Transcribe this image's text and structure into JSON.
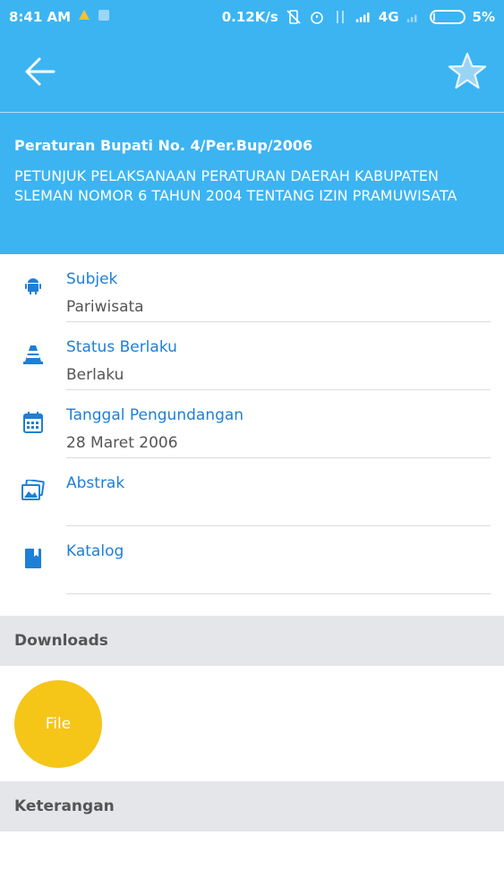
{
  "status_bar": {
    "time": "8:41 AM",
    "speed": "0.12K/s",
    "network": "4G",
    "battery": "5%"
  },
  "toolbar": {
    "back_icon": "arrow-left-icon",
    "favorite_icon": "star-icon"
  },
  "regulation": {
    "title": "Peraturan Bupati No. 4/Per.Bup/2006",
    "description": "PETUNJUK PELAKSANAAN PERATURAN DAERAH KABUPATEN SLEMAN NOMOR 6 TAHUN 2004 TENTANG IZIN PRAMUWISATA"
  },
  "details": [
    {
      "label": "Subjek",
      "value": "Pariwisata",
      "icon": "android-icon"
    },
    {
      "label": "Status Berlaku",
      "value": "Berlaku",
      "icon": "cone-icon"
    },
    {
      "label": "Tanggal Pengundangan",
      "value": "28 Maret 2006",
      "icon": "calendar-icon"
    },
    {
      "label": "Abstrak",
      "value": "",
      "icon": "photos-icon"
    },
    {
      "label": "Katalog",
      "value": "",
      "icon": "book-icon"
    }
  ],
  "downloads": {
    "heading": "Downloads",
    "file_label": "File"
  },
  "keterangan": {
    "heading": "Keterangan"
  },
  "colors": {
    "primary": "#3cb4f2",
    "label_blue": "#1e7fd6",
    "file_yellow": "#f5c518"
  }
}
